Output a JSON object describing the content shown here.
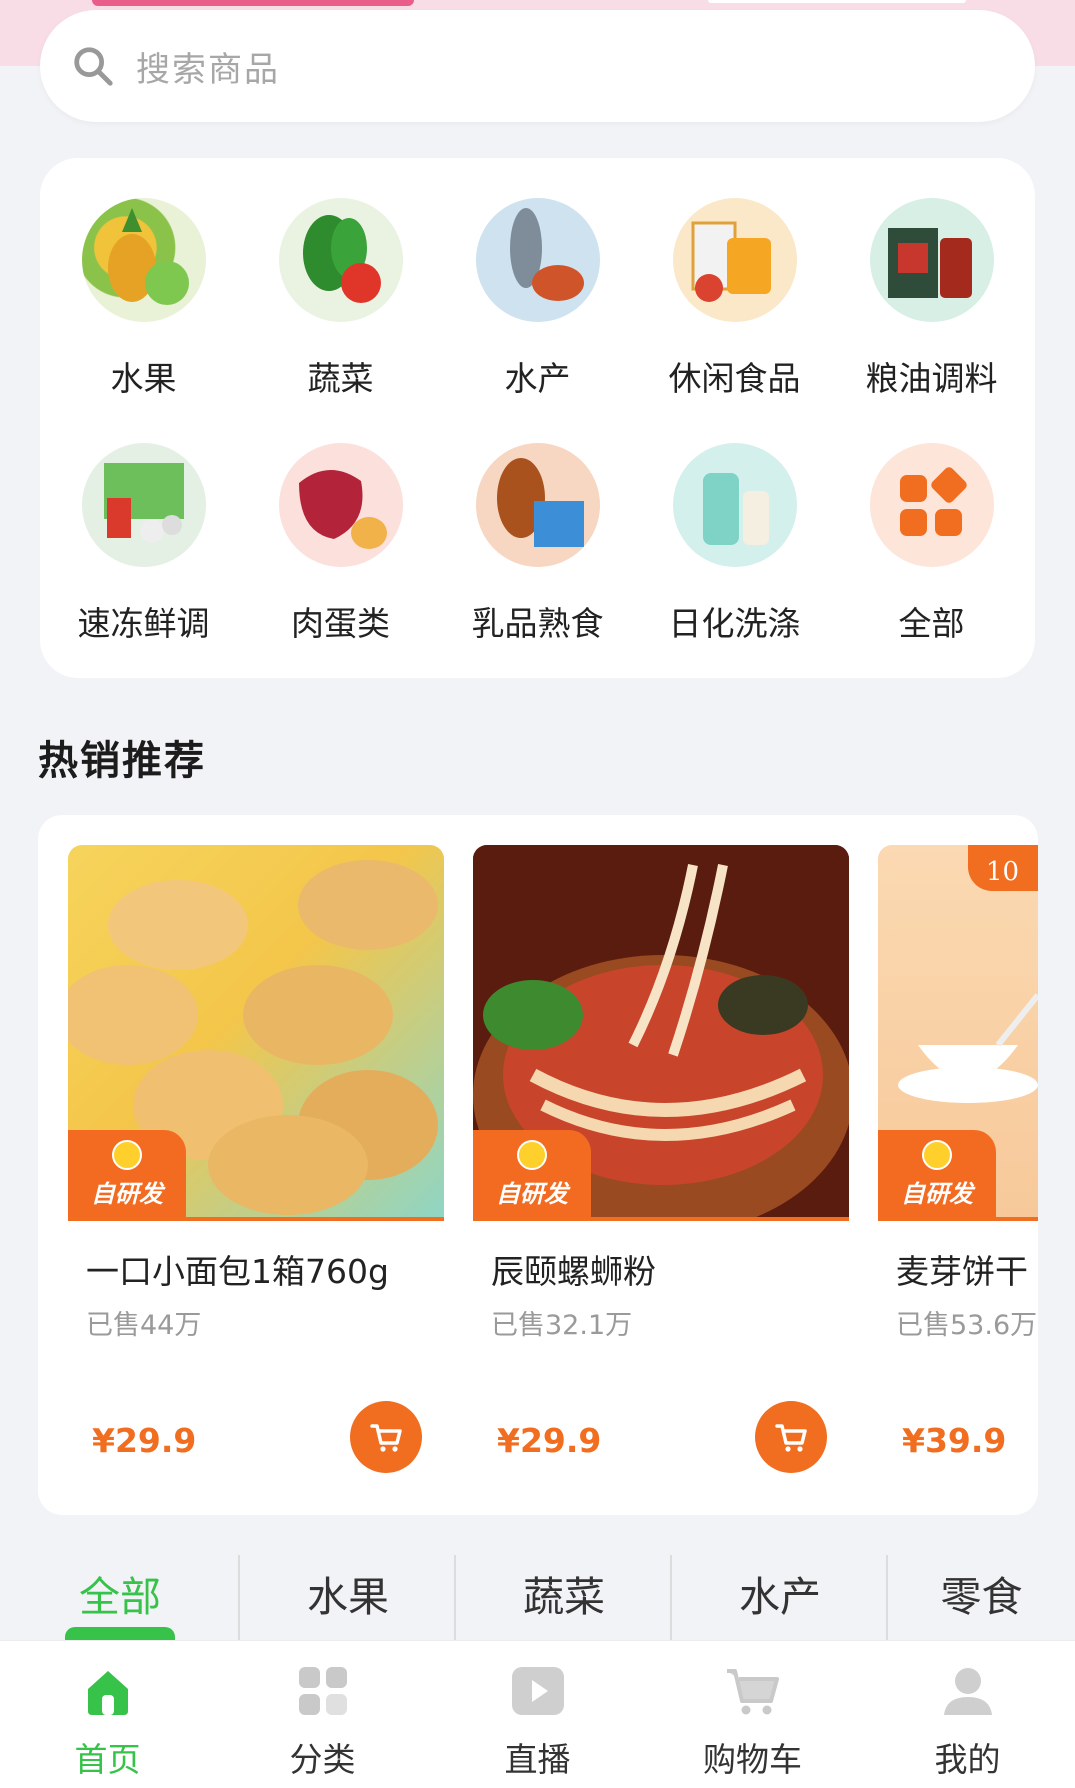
{
  "search": {
    "placeholder": "搜索商品"
  },
  "categories": [
    {
      "label": "水果",
      "icon": "fruit-icon"
    },
    {
      "label": "蔬菜",
      "icon": "vegetable-icon"
    },
    {
      "label": "水产",
      "icon": "seafood-icon"
    },
    {
      "label": "休闲食品",
      "icon": "snack-icon"
    },
    {
      "label": "粮油调料",
      "icon": "grain-oil-icon"
    },
    {
      "label": "速冻鲜调",
      "icon": "frozen-food-icon"
    },
    {
      "label": "肉蛋类",
      "icon": "meat-egg-icon"
    },
    {
      "label": "乳品熟食",
      "icon": "dairy-deli-icon"
    },
    {
      "label": "日化洗涤",
      "icon": "detergent-icon"
    },
    {
      "label": "全部",
      "icon": "all-categories-icon"
    }
  ],
  "hot": {
    "title": "热销推荐",
    "products": [
      {
        "name": "一口小面包1箱760g",
        "sold": "已售44万",
        "price": "¥29.9",
        "badge": "自研发"
      },
      {
        "name": "辰颐螺蛳粉",
        "sold": "已售32.1万",
        "price": "¥29.9",
        "badge": "自研发"
      },
      {
        "name": "麦芽饼干",
        "sold": "已售53.6万",
        "price": "¥39.9",
        "badge": "自研发",
        "corner": "10"
      }
    ]
  },
  "filters": [
    {
      "label": "全部",
      "active": true
    },
    {
      "label": "水果",
      "active": false
    },
    {
      "label": "蔬菜",
      "active": false
    },
    {
      "label": "水产",
      "active": false
    },
    {
      "label": "零食",
      "active": false
    }
  ],
  "tabbar": [
    {
      "label": "首页",
      "icon": "home-icon",
      "active": true
    },
    {
      "label": "分类",
      "icon": "category-icon",
      "active": false
    },
    {
      "label": "直播",
      "icon": "live-icon",
      "active": false
    },
    {
      "label": "购物车",
      "icon": "cart-icon",
      "active": false
    },
    {
      "label": "我的",
      "icon": "profile-icon",
      "active": false
    }
  ],
  "colors": {
    "accent_orange": "#f16d1f",
    "accent_green": "#37c24a",
    "top_band": "#f9dde6"
  }
}
